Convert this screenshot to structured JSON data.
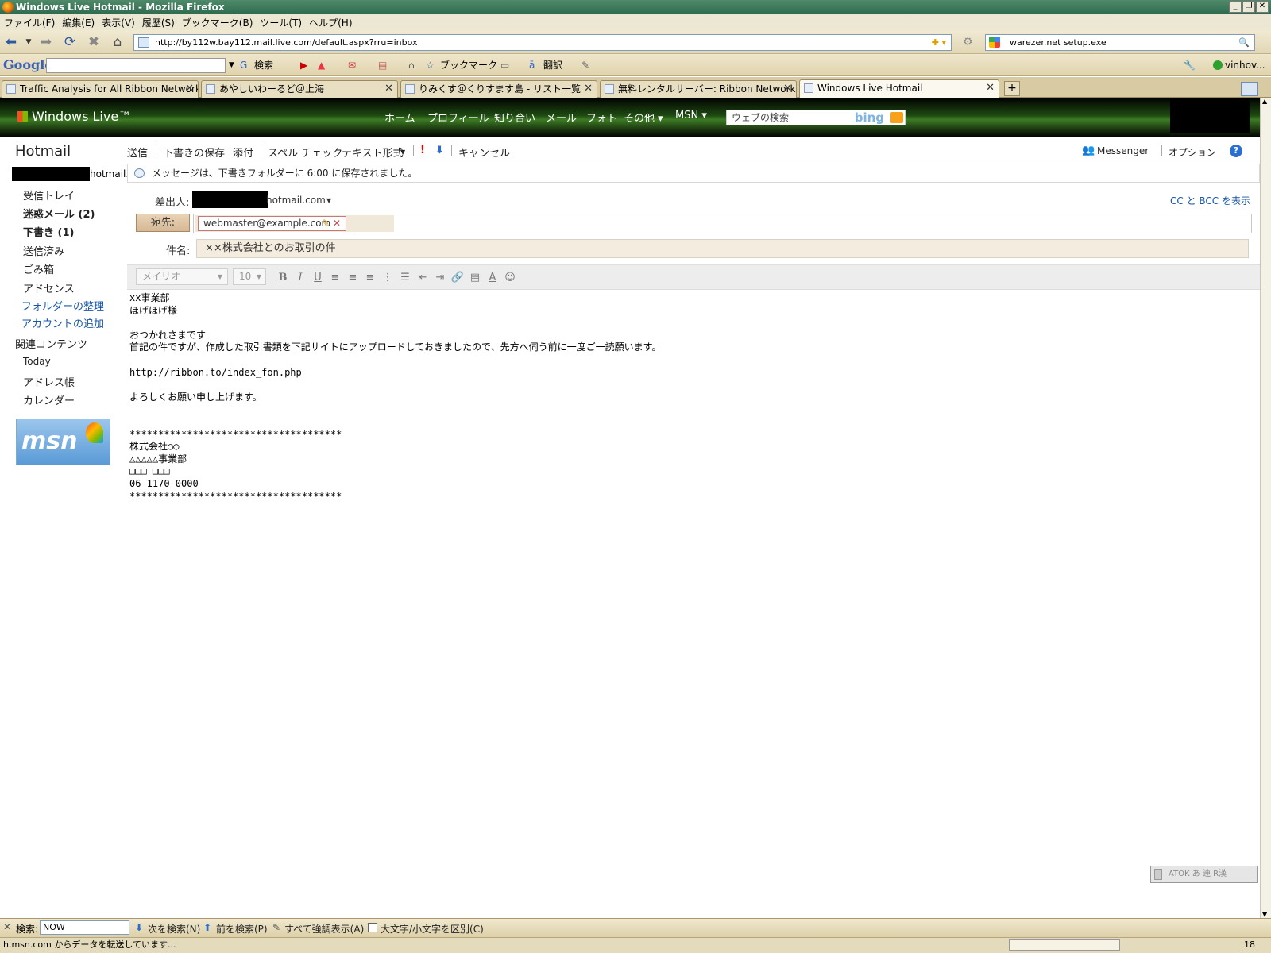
{
  "window": {
    "title": "Windows Live Hotmail - Mozilla Firefox"
  },
  "menu": [
    "ファイル(F)",
    "編集(E)",
    "表示(V)",
    "履歴(S)",
    "ブックマーク(B)",
    "ツール(T)",
    "ヘルプ(H)"
  ],
  "nav": {
    "url": "http://by112w.bay112.mail.live.com/default.aspx?rru=inbox",
    "search": "warezer.net setup.exe"
  },
  "google_toolbar": {
    "logo": "Google",
    "search_label": "検索",
    "bookmarks_label": "ブックマーク",
    "translate_label": "翻訳",
    "user": "vinhov..."
  },
  "tabs": [
    {
      "label": "Traffic Analysis for All Ribbon Network"
    },
    {
      "label": "あやしいわーるど＠上海"
    },
    {
      "label": "りみくす＠くりすます島 - リスト一覧"
    },
    {
      "label": "無料レンタルサーバー: Ribbon Network | ..."
    },
    {
      "label": "Windows Live Hotmail"
    }
  ],
  "live": {
    "brand": "Windows Live™",
    "nav": [
      "ホーム",
      "プロフィール",
      "知り合い",
      "メール",
      "フォト",
      "その他 ▾",
      "MSN ▾"
    ],
    "search_placeholder": "ウェブの検索",
    "search_brand": "bing"
  },
  "sidebar": {
    "title": "Hotmail",
    "account_suffix": "hotmail.",
    "folders": [
      {
        "label": "受信トレイ"
      },
      {
        "label": "迷惑メール (2)"
      },
      {
        "label": "下書き (1)"
      },
      {
        "label": "送信済み"
      },
      {
        "label": "ごみ箱"
      },
      {
        "label": "アドセンス"
      }
    ],
    "links": [
      "フォルダーの整理",
      "アカウントの追加"
    ],
    "related_heading": "関連コンテンツ",
    "related": [
      "Today",
      "アドレス帳",
      "カレンダー"
    ],
    "msn_logo": "msn"
  },
  "toolbar": {
    "send": "送信",
    "save_draft": "下書きの保存",
    "attach": "添付",
    "spell": "スペル チェック",
    "text_format": "テキスト形式",
    "cancel": "キャンセル",
    "messenger": "Messenger",
    "options": "オプション",
    "help": "?"
  },
  "notice": "メッセージは、下書きフォルダーに 6:00 に保存されました。",
  "compose": {
    "from_label": "差出人:",
    "from_suffix": "hotmail.com",
    "cc_bcc": "CC と BCC を表示",
    "to_label": "宛先:",
    "to_recipient": "webmaster@example.com",
    "subject_label": "件名:",
    "subject": "××株式会社とのお取引の件"
  },
  "format": {
    "font": "メイリオ",
    "size": "10"
  },
  "body": "xx事業部\nほげほげ様\n\nおつかれさまです\n首記の件ですが、作成した取引書類を下記サイトにアップロードしておきましたので、先方へ伺う前に一度ご一読願います。\n\nhttp://ribbon.to/index_fon.php\n\nよろしくお願い申し上げます。\n\n\n*************************************\n株式会社○○\n△△△△△事業部\n□□□ □□□\n06-1170-0000\n*************************************",
  "ime": "ATOK あ 連 R漢",
  "findbar": {
    "label": "検索:",
    "value": "NOW",
    "next": "次を検索(N)",
    "prev": "前を検索(P)",
    "highlight": "すべて強調表示(A)",
    "match_case": "大文字/小文字を区別(C)"
  },
  "status": {
    "text": "h.msn.com からデータを転送しています...",
    "right": "18"
  }
}
